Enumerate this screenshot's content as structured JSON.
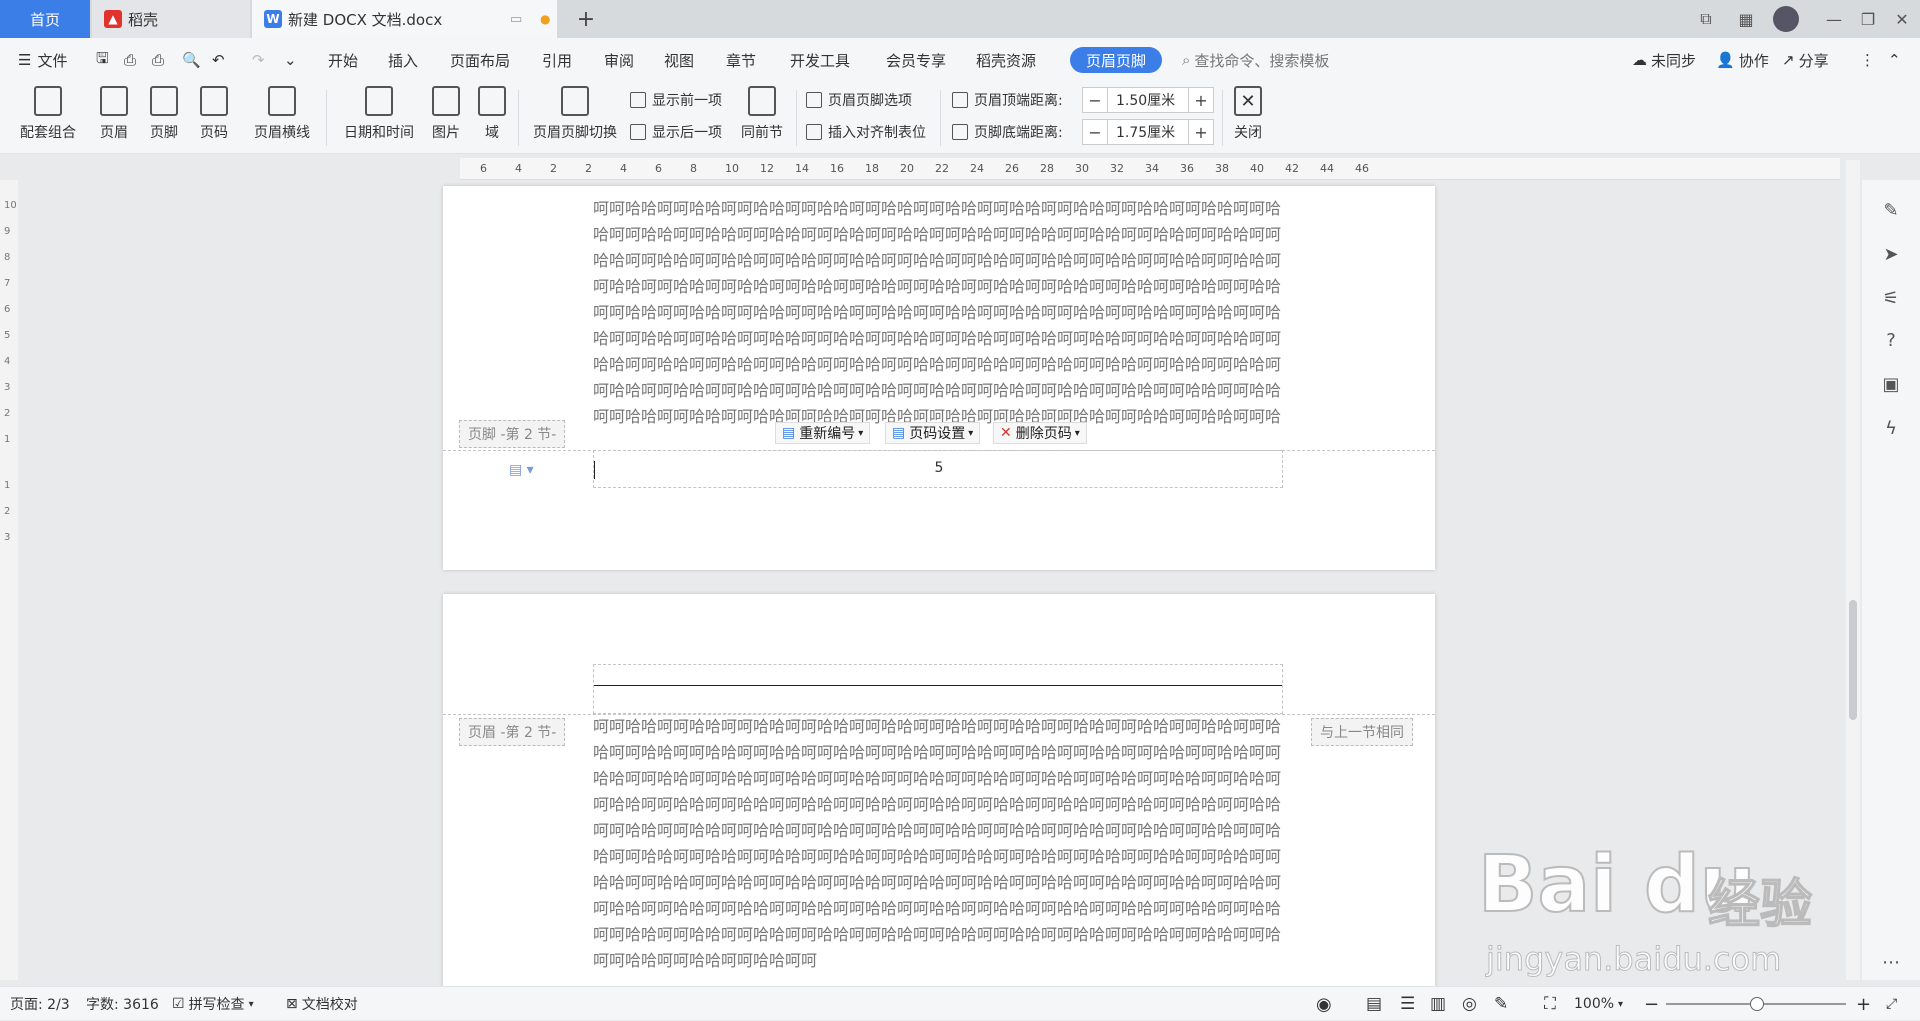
{
  "tabs": {
    "home": "首页",
    "daoke": "稻壳",
    "doc": "新建 DOCX 文档.docx",
    "add": "+"
  },
  "menu": {
    "file": "文件",
    "items": [
      "开始",
      "插入",
      "页面布局",
      "引用",
      "审阅",
      "视图",
      "章节",
      "开发工具",
      "会员专享",
      "稻壳资源"
    ],
    "active": "页眉页脚",
    "search": "查找命令、搜索模板",
    "sync": "未同步",
    "collab": "协作",
    "share": "分享"
  },
  "ribbon": {
    "combo": "配套组合",
    "header": "页眉",
    "footer": "页脚",
    "pagenum": "页码",
    "header_line": "页眉横线",
    "datetime": "日期和时间",
    "picture": "图片",
    "field": "域",
    "switch": "页眉页脚切换",
    "show_prev": "显示前一项",
    "show_next": "显示后一项",
    "same_section": "同前节",
    "hf_options": "页眉页脚选项",
    "insert_tab": "插入对齐制表位",
    "top_dist_label": "页眉顶端距离:",
    "top_dist_value": "1.50厘米",
    "bottom_dist_label": "页脚底端距离:",
    "bottom_dist_value": "1.75厘米",
    "close": "关闭"
  },
  "ruler": {
    "marks": [
      "6",
      "4",
      "2",
      "2",
      "4",
      "6",
      "8",
      "10",
      "12",
      "14",
      "16",
      "18",
      "20",
      "22",
      "24",
      "26",
      "28",
      "30",
      "32",
      "34",
      "36",
      "38",
      "40",
      "42",
      "44",
      "46"
    ],
    "vmarks": [
      "10",
      "9",
      "8",
      "7",
      "6",
      "5",
      "4",
      "3",
      "2",
      "1",
      "1",
      "2",
      "3"
    ]
  },
  "page1": {
    "lines": [
      "呵呵哈哈呵呵哈哈呵呵哈哈呵呵哈哈呵呵哈哈呵呵哈哈呵呵哈哈呵呵哈哈呵呵哈哈呵呵哈哈呵呵哈",
      "哈呵呵哈哈呵呵哈哈呵呵哈哈呵呵哈哈呵呵哈哈呵呵哈哈呵呵哈哈呵呵哈哈呵呵哈哈呵呵哈哈呵呵",
      "哈哈呵呵哈哈呵呵哈哈呵呵哈哈呵呵哈哈呵呵哈哈呵呵哈哈呵呵哈哈呵呵哈哈呵呵哈哈呵呵哈哈呵",
      "呵哈哈呵呵哈哈呵呵哈哈呵呵哈哈呵呵哈哈呵呵哈哈呵呵哈哈呵呵哈哈呵呵哈哈呵呵哈哈呵呵哈哈",
      "呵呵哈哈呵呵哈哈呵呵哈哈呵呵哈哈呵呵哈哈呵呵哈哈呵呵哈哈呵呵哈哈呵呵哈哈呵呵哈哈呵呵哈",
      "哈呵呵哈哈呵呵哈哈呵呵哈哈呵呵哈哈呵呵哈哈呵呵哈哈呵呵哈哈呵呵哈哈呵呵哈哈呵呵哈哈呵呵",
      "哈哈呵呵哈哈呵呵哈哈呵呵哈哈呵呵哈哈呵呵哈哈呵呵哈哈呵呵哈哈呵呵哈哈呵呵哈哈呵呵哈哈呵",
      "呵哈哈呵呵哈哈呵呵哈哈呵呵哈哈呵呵哈哈呵呵哈哈呵呵哈哈呵呵哈哈呵呵哈哈呵呵哈哈呵呵哈哈",
      "呵呵哈哈呵呵哈哈呵呵哈哈呵呵哈哈呵呵哈哈呵呵哈哈呵呵哈哈呵呵哈哈呵呵哈哈呵呵哈哈呵呵哈"
    ],
    "footer_label": "页脚 -第 2 节-",
    "renumber": "重新编号",
    "pagenum_settings": "页码设置",
    "delete_pagenum": "删除页码",
    "page_number": "5"
  },
  "page2": {
    "header_label": "页眉 -第 2 节-",
    "same_as_prev": "与上一节相同",
    "lines": [
      "呵呵哈哈呵呵哈哈呵呵哈哈呵呵哈哈呵呵哈哈呵呵哈哈呵呵哈哈呵呵哈哈呵呵哈哈呵呵哈哈呵呵哈",
      "哈呵呵哈哈呵呵哈哈呵呵哈哈呵呵哈哈呵呵哈哈呵呵哈哈呵呵哈哈呵呵哈哈呵呵哈哈呵呵哈哈呵呵",
      "哈哈呵呵哈哈呵呵哈哈呵呵哈哈呵呵哈哈呵呵哈哈呵呵哈哈呵呵哈哈呵呵哈哈呵呵哈哈呵呵哈哈呵",
      "呵哈哈呵呵哈哈呵呵哈哈呵呵哈哈呵呵哈哈呵呵哈哈呵呵哈哈呵呵哈哈呵呵哈哈呵呵哈哈呵呵哈哈",
      "呵呵哈哈呵呵哈哈呵呵哈哈呵呵哈哈呵呵哈哈呵呵哈哈呵呵哈哈呵呵哈哈呵呵哈哈呵呵哈哈呵呵哈",
      "哈呵呵哈哈呵呵哈哈呵呵哈哈呵呵哈哈呵呵哈哈呵呵哈哈呵呵哈哈呵呵哈哈呵呵哈哈呵呵哈哈呵呵",
      "哈哈呵呵哈哈呵呵哈哈呵呵哈哈呵呵哈哈呵呵哈哈呵呵哈哈呵呵哈哈呵呵哈哈呵呵哈哈呵呵哈哈呵",
      "呵哈哈呵呵哈哈呵呵哈哈呵呵哈哈呵呵哈哈呵呵哈哈呵呵哈哈呵呵哈哈呵呵哈哈呵呵哈哈呵呵哈哈",
      "呵呵哈哈呵呵哈哈呵呵哈哈呵呵哈哈呵呵哈哈呵呵哈哈呵呵哈哈呵呵哈哈呵呵哈哈呵呵哈哈呵呵哈",
      "呵呵哈哈呵呵哈哈呵呵哈哈呵呵"
    ]
  },
  "status": {
    "page": "页面: 2/3",
    "words": "字数: 3616",
    "spell": "拼写检查",
    "proof": "文档校对",
    "zoom": "100%"
  },
  "watermark": {
    "logo": "Bai du",
    "cn": "经验",
    "url": "jingyan.baidu.com"
  },
  "colors": {
    "accent": "#3c7ee8",
    "delete_red": "#d9362b"
  }
}
